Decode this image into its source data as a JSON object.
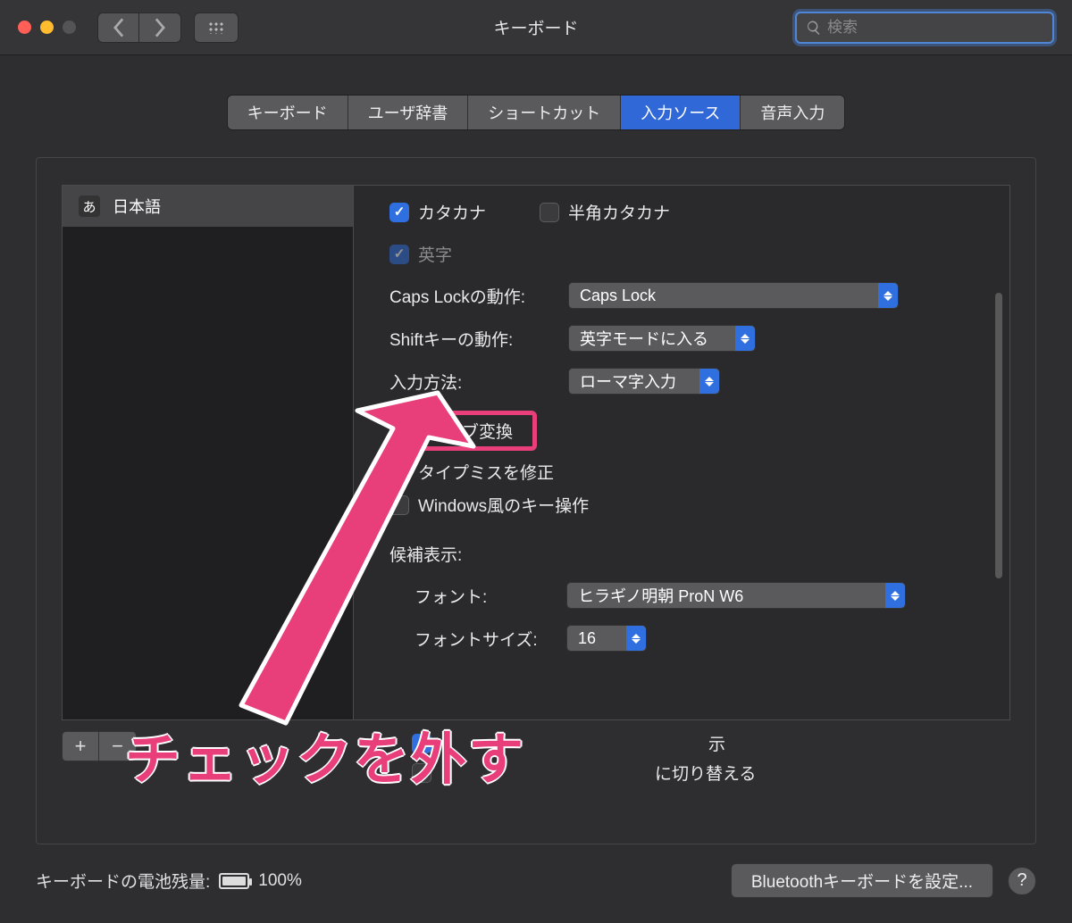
{
  "window": {
    "title": "キーボード"
  },
  "search": {
    "placeholder": "検索"
  },
  "tabs": {
    "keyboard": "キーボード",
    "userdict": "ユーザ辞書",
    "shortcut": "ショートカット",
    "inputsrc": "入力ソース",
    "voice": "音声入力"
  },
  "sidebar": {
    "items": [
      {
        "badge": "あ",
        "label": "日本語"
      }
    ]
  },
  "content": {
    "katakana": "カタカナ",
    "half_katakana": "半角カタカナ",
    "eiji": "英字",
    "capslock_label": "Caps Lockの動作:",
    "capslock_value": "Caps Lock",
    "shift_label": "Shiftキーの動作:",
    "shift_value": "英字モードに入る",
    "input_method_label": "入力方法:",
    "input_method_value": "ローマ字入力",
    "live_conversion": "ライブ変換",
    "typo_fix": "タイプミスを修正",
    "windows_keys": "Windows風のキー操作",
    "candidate_title": "候補表示:",
    "font_label": "フォント:",
    "font_value": "ヒラギノ明朝 ProN W6",
    "fontsize_label": "フォントサイズ:",
    "fontsize_value": "16",
    "extra1_suffix": "示",
    "extra2_suffix": "に切り替える"
  },
  "list_buttons": {
    "add": "+",
    "remove": "−"
  },
  "bottom": {
    "battery_label": "キーボードの電池残量:",
    "battery_pct": "100%",
    "bluetooth_btn": "Bluetoothキーボードを設定...",
    "help": "?"
  },
  "annotation": {
    "text": "チェックを外す"
  }
}
